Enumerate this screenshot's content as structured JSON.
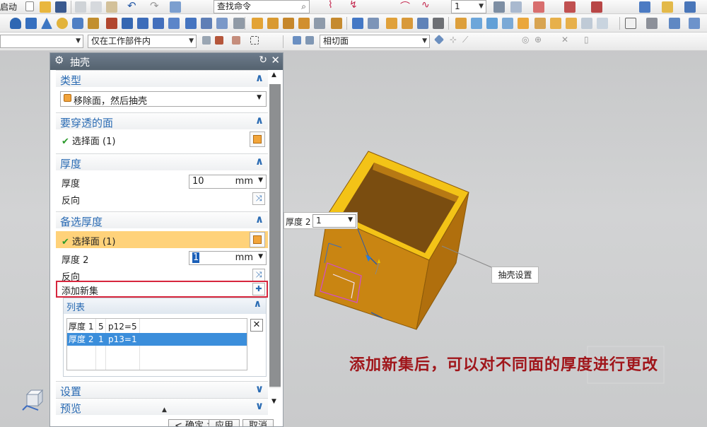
{
  "toolbar": {
    "start_label": "启动",
    "command_search_placeholder": "查找命令",
    "number_value": "1",
    "selection_scope": "仅在工作部件内",
    "section_view": "相切面"
  },
  "colors": {
    "title_bar": "#5d6b78",
    "section_header": "#2a6bb3",
    "highlight_row": "#ffd27a",
    "annotation_red": "#a0161b",
    "model_face": "#c98512",
    "model_rim": "#f5c814"
  },
  "dialog": {
    "title": "抽壳",
    "type": {
      "header": "类型",
      "value": "移除面，然后抽壳"
    },
    "faces_to_pierce": {
      "header": "要穿透的面",
      "select_label": "选择面 (1)"
    },
    "thickness": {
      "header": "厚度",
      "label": "厚度",
      "value": "10",
      "unit": "mm",
      "reverse_label": "反向"
    },
    "alt_thickness": {
      "header": "备选厚度",
      "select_label": "选择面 (1)",
      "thickness2_label": "厚度 2",
      "thickness2_value": "1",
      "unit": "mm",
      "reverse_label": "反向",
      "add_new_set_label": "添加新集"
    },
    "list": {
      "header": "列表",
      "rows": [
        {
          "name": "厚度 1",
          "value": "5",
          "expr": "p12=5"
        },
        {
          "name": "厚度 2",
          "value": "1",
          "expr": "p13=1"
        }
      ]
    },
    "settings_header": "设置",
    "preview_header": "预览",
    "buttons": {
      "ok": "< 确定 >",
      "apply": "应用",
      "cancel": "取消"
    }
  },
  "viewport": {
    "thickness_callout_label": "厚度 2",
    "thickness_callout_value": "1",
    "shell_settings_callout": "抽壳设置",
    "caption": "添加新集后，可以对不同面的厚度进行更改"
  }
}
